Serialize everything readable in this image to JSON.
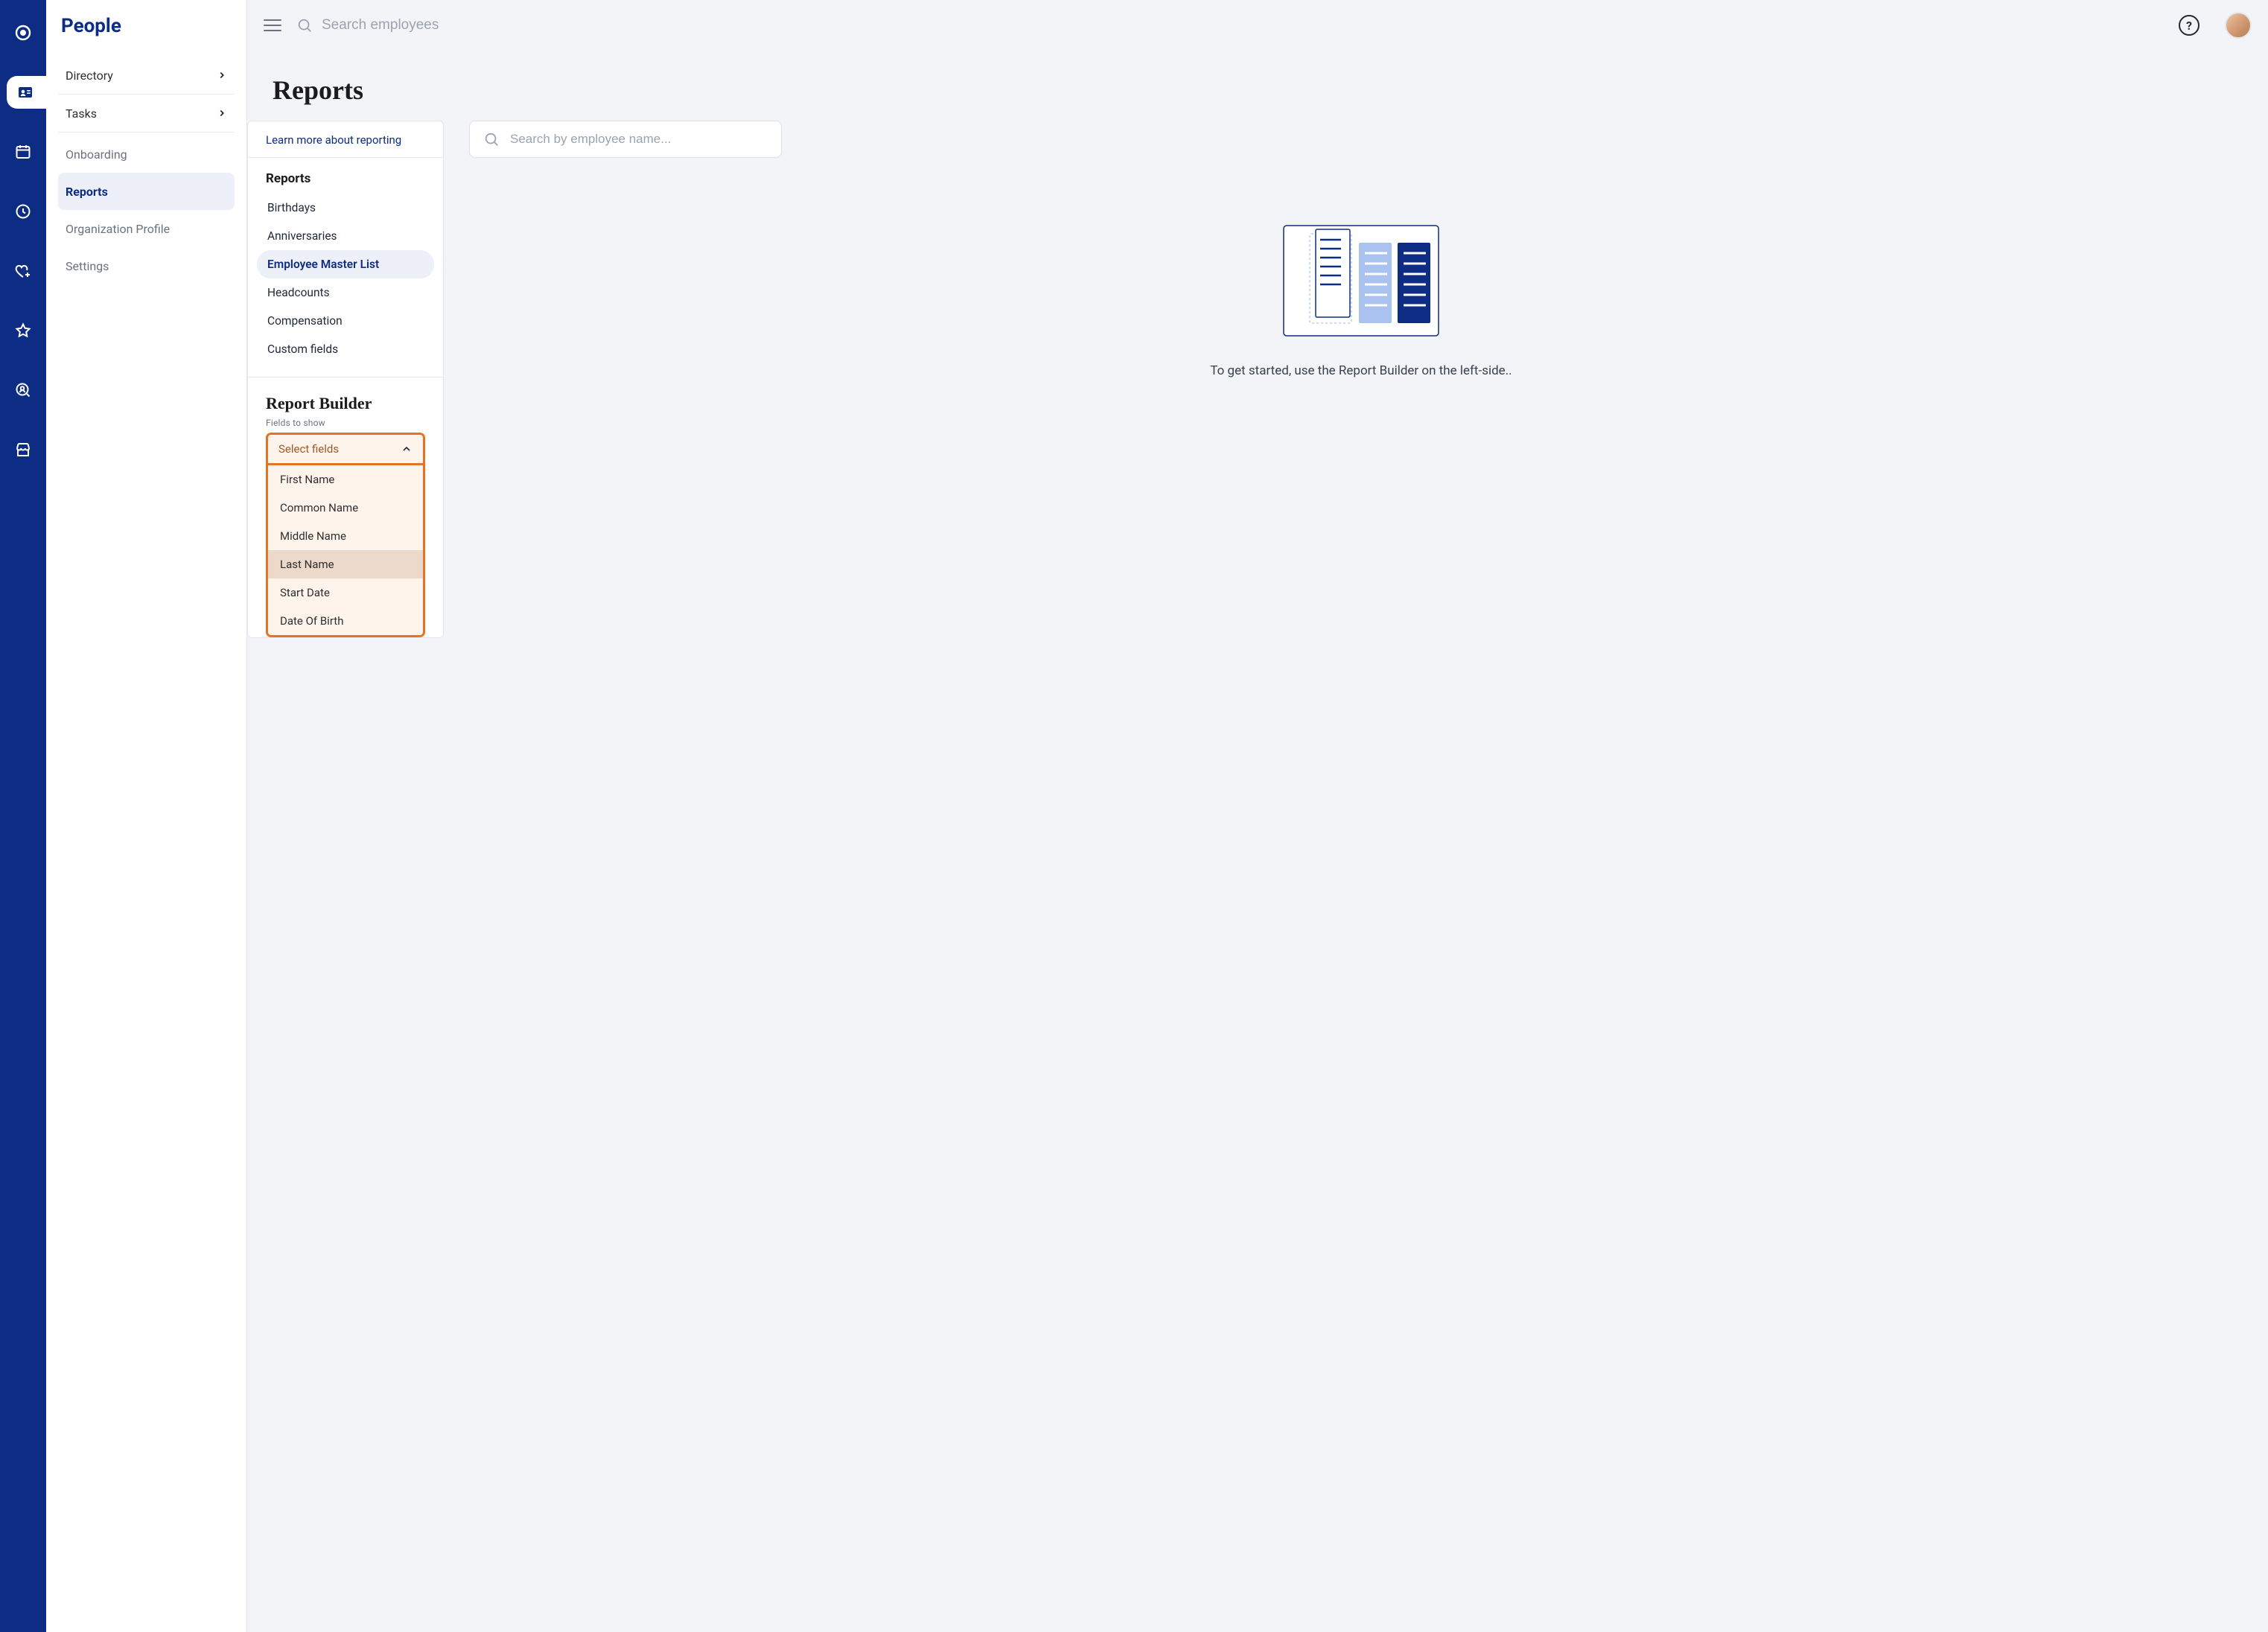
{
  "module_title": "People",
  "sidebar": {
    "directory": "Directory",
    "tasks": "Tasks",
    "onboarding": "Onboarding",
    "reports": "Reports",
    "org_profile": "Organization Profile",
    "settings": "Settings"
  },
  "topbar": {
    "search_placeholder": "Search employees"
  },
  "page_title": "Reports",
  "reports_panel": {
    "learn_more": "Learn more about reporting",
    "section_head": "Reports",
    "items": {
      "birthdays": "Birthdays",
      "anniversaries": "Anniversaries",
      "employee_master": "Employee Master List",
      "headcounts": "Headcounts",
      "compensation": "Compensation",
      "custom_fields": "Custom fields"
    }
  },
  "builder": {
    "title": "Report Builder",
    "sublabel": "Fields to show",
    "placeholder": "Select fields",
    "options": {
      "first_name": "First Name",
      "common_name": "Common Name",
      "middle_name": "Middle Name",
      "last_name": "Last Name",
      "start_date": "Start Date",
      "dob": "Date Of Birth"
    }
  },
  "right": {
    "search_placeholder": "Search by employee name...",
    "hint": "To get started, use the Report Builder on the left-side.."
  },
  "colors": {
    "brand": "#0c2d83",
    "accent": "#e57324"
  }
}
